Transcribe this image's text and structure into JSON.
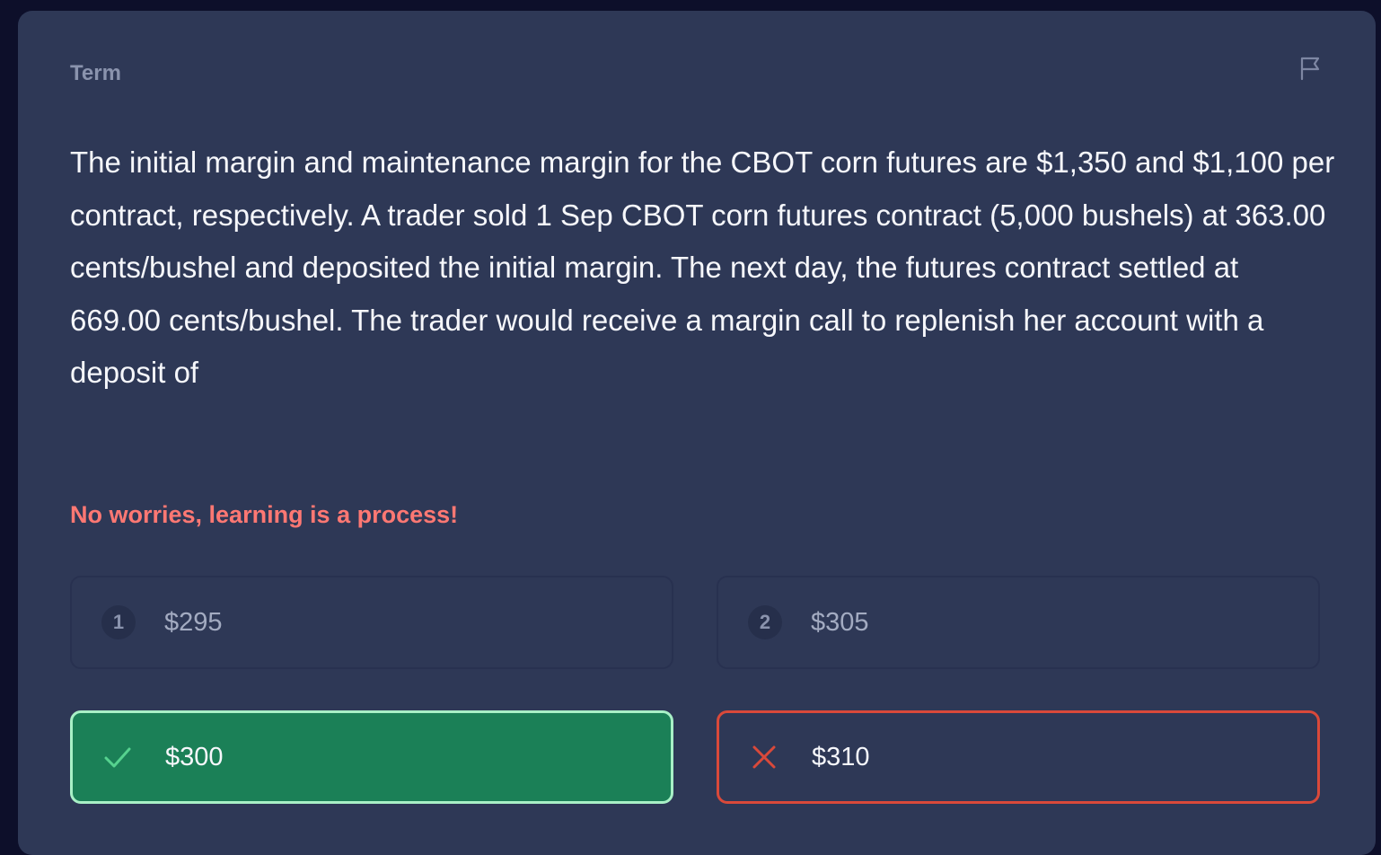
{
  "card": {
    "label": "Term",
    "flag_icon": "flag-icon"
  },
  "question": {
    "text": "The initial margin and maintenance margin for the CBOT corn futures are $1,350 and $1,100 per contract, respectively. A trader sold 1 Sep CBOT corn futures contract (5,000 bushels) at 363.00 cents/bushel and deposited the initial margin. The next day, the futures contract settled at 669.00 cents/bushel. The trader would receive a margin call to replenish her account with a deposit of"
  },
  "feedback": {
    "text": "No worries, learning is a process!",
    "color": "#ff7873"
  },
  "options": [
    {
      "number": "1",
      "text": "$295",
      "state": "unselected"
    },
    {
      "number": "2",
      "text": "$305",
      "state": "unselected"
    },
    {
      "icon": "checkmark-icon",
      "text": "$300",
      "state": "correct"
    },
    {
      "icon": "x-icon",
      "text": "$310",
      "state": "incorrect"
    }
  ],
  "colors": {
    "background": "#0d0f2a",
    "card": "#2e3856",
    "correct_fill": "#1b8057",
    "correct_border": "#a8f0c6",
    "wrong_border": "#d9493a",
    "check": "#56d28f"
  }
}
